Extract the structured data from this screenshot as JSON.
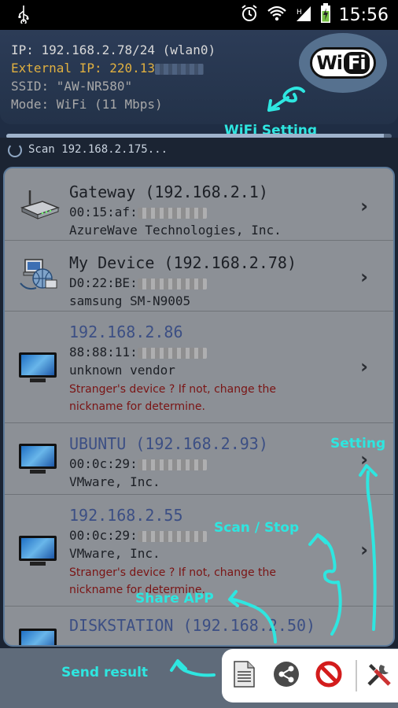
{
  "status_bar": {
    "time": "15:56"
  },
  "header": {
    "ip_line": "IP: 192.168.2.78/24 (wlan0)",
    "external_ip_line": "External IP: 220.13",
    "ssid_line": "SSID: \"AW-NR580\"",
    "mode_line": "Mode: WiFi (11 Mbps)",
    "wifi_logo": {
      "left": "Wi",
      "right": "Fi"
    },
    "progress_fraction": 0.98
  },
  "scan": {
    "text": "Scan 192.168.2.175..."
  },
  "devices": [
    {
      "name": "Gateway (192.168.2.1)",
      "mac": "00:15:af:",
      "vendor": "AzureWave Technologies, Inc.",
      "icon": "router-icon"
    },
    {
      "name": "My Device (192.168.2.78)",
      "mac": "D0:22:BE:",
      "vendor": "samsung SM-N9005",
      "icon": "network-computer-icon"
    },
    {
      "name": "192.168.2.86",
      "mac": "88:88:11:",
      "vendor": "unknown vendor",
      "warning": "Stranger's device ? If not, change the nickname for determine.",
      "icon": "monitor-icon"
    },
    {
      "name": "UBUNTU (192.168.2.93)",
      "mac": "00:0c:29:",
      "vendor": "VMware, Inc.",
      "icon": "monitor-icon"
    },
    {
      "name": "192.168.2.55",
      "mac": "00:0c:29:",
      "vendor": "VMware, Inc.",
      "warning": "Stranger's device ? If not, change the nickname for determine.",
      "icon": "monitor-icon"
    },
    {
      "name": "DISKSTATION (192.168.2.50)",
      "icon": "monitor-icon"
    }
  ],
  "annotations": {
    "wifi_setting": "WiFi Setting",
    "setting": "Setting",
    "scan_stop": "Scan / Stop",
    "share_app": "Share APP",
    "send_result": "Send result"
  },
  "colors": {
    "annotation": "#2ee6e0",
    "warning_text": "#7a1414",
    "device_name_blue": "#3c4f84",
    "external_ip": "#e0b040"
  },
  "toolbar": {
    "icons": [
      "document-icon",
      "share-icon",
      "stop-icon",
      "tools-icon"
    ]
  }
}
